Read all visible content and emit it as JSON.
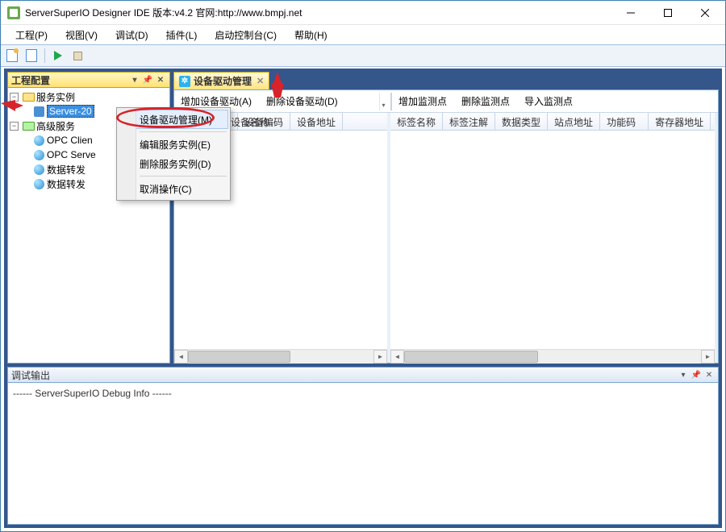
{
  "title": "ServerSuperIO Designer IDE 版本:v4.2 官网:http://www.bmpj.net",
  "menus": [
    "工程(P)",
    "视图(V)",
    "调试(D)",
    "插件(L)",
    "启动控制台(C)",
    "帮助(H)"
  ],
  "panels": {
    "project": {
      "title": "工程配置"
    },
    "output": {
      "title": "调试输出",
      "line0": "------ ServerSuperIO Debug Info ------"
    }
  },
  "tree": {
    "root0": "服务实例",
    "root0_child0": "Server-20",
    "root1": "高级服务",
    "root1_children": [
      "OPC Clien",
      "OPC Serve",
      "数据转发",
      "数据转发"
    ]
  },
  "doc": {
    "tab_label": "设备驱动管理",
    "left_toolbar": {
      "add": "增加设备驱动(A)",
      "del": "删除设备驱动(D)"
    },
    "right_toolbar": {
      "add": "增加监测点",
      "del": "删除监测点",
      "imp": "导入监测点"
    },
    "left_cols": [
      "设备名称",
      "设备编码",
      "设备地址"
    ],
    "right_cols": [
      "标签名称",
      "标签注解",
      "数据类型",
      "站点地址",
      "功能码",
      "寄存器地址"
    ]
  },
  "ctx": {
    "items": [
      "设备驱动管理(M)",
      "编辑服务实例(E)",
      "删除服务实例(D)",
      "取消操作(C)"
    ]
  }
}
